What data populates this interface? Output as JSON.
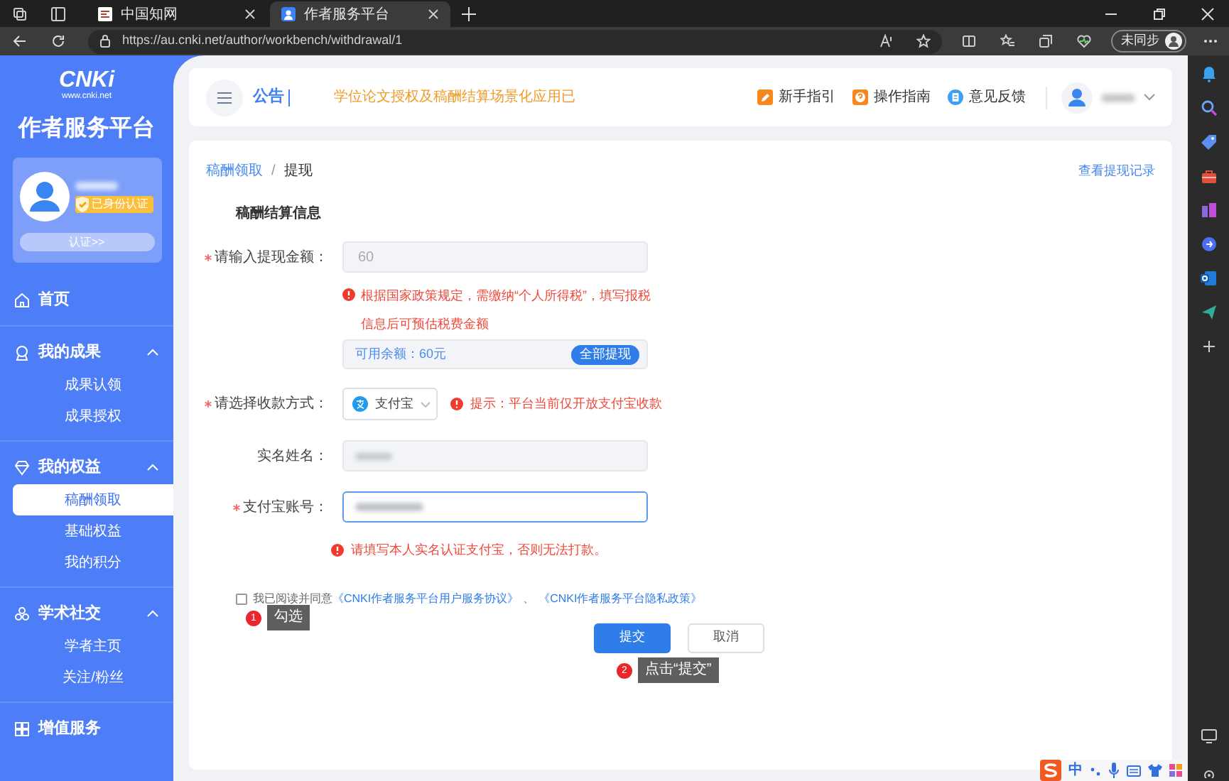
{
  "browser": {
    "tabs": [
      {
        "title": "中国知网",
        "selected": false
      },
      {
        "title": "作者服务平台",
        "selected": true
      }
    ],
    "url": "https://au.cnki.net/author/workbench/withdrawal/1",
    "sync_label": "未同步"
  },
  "sidebar": {
    "logo": {
      "mark": "CNKi",
      "site": "www.cnki.net"
    },
    "platform_title": "作者服务平台",
    "profile": {
      "badge": "已身份认证",
      "verify_button": "认证>>"
    },
    "nav": [
      {
        "label": "首页"
      },
      {
        "label": "我的成果",
        "expanded": true,
        "children": [
          {
            "label": "成果认领",
            "selected": false
          },
          {
            "label": "成果授权",
            "selected": false
          }
        ]
      },
      {
        "label": "我的权益",
        "expanded": true,
        "children": [
          {
            "label": "稿酬领取",
            "selected": true
          },
          {
            "label": "基础权益",
            "selected": false
          },
          {
            "label": "我的积分",
            "selected": false
          }
        ]
      },
      {
        "label": "学术社交",
        "expanded": true,
        "children": [
          {
            "label": "学者主页",
            "selected": false
          },
          {
            "label": "关注/粉丝",
            "selected": false
          }
        ]
      },
      {
        "label": "增值服务"
      }
    ]
  },
  "header": {
    "notice_label": "公告",
    "notice_text": "学位论文授权及稿酬结算场景化应用已",
    "links": [
      {
        "label": "新手指引",
        "kind": "guide"
      },
      {
        "label": "操作指南",
        "kind": "help"
      },
      {
        "label": "意见反馈",
        "kind": "feedback"
      }
    ]
  },
  "breadcrumb": {
    "items": [
      "稿酬领取",
      "提现"
    ],
    "separator": "/"
  },
  "record_link": "查看提现记录",
  "form": {
    "section_title": "稿酬结算信息",
    "amount": {
      "label": "请输入提现金额：",
      "required": true,
      "value": "60",
      "warning": "根据国家政策规定，需缴纳“个人所得税”，填写报税信息后可预估税费金额"
    },
    "balance": {
      "text": "可用余额：60元",
      "button": "全部提现"
    },
    "method": {
      "label": "请选择收款方式：",
      "required": true,
      "value": "支付宝",
      "hint": "提示：平台当前仅开放支付宝收款"
    },
    "real_name": {
      "label": "实名姓名：",
      "required": false
    },
    "account": {
      "label": "支付宝账号：",
      "required": true,
      "focused": true,
      "warning": "请填写本人实名认证支付宝，否则无法打款。"
    },
    "agreement": {
      "checked": false,
      "text": "我已阅读并同意",
      "links": [
        "《CNKI作者服务平台用户服务协议》",
        "《CNKI作者服务平台隐私政策》"
      ],
      "separator": "、"
    },
    "submit": "提交",
    "cancel": "取消"
  },
  "callouts": [
    {
      "number": "1",
      "text": "勾选"
    },
    {
      "number": "2",
      "text": "点击“提交”"
    }
  ],
  "ime": {
    "mode": "中"
  }
}
